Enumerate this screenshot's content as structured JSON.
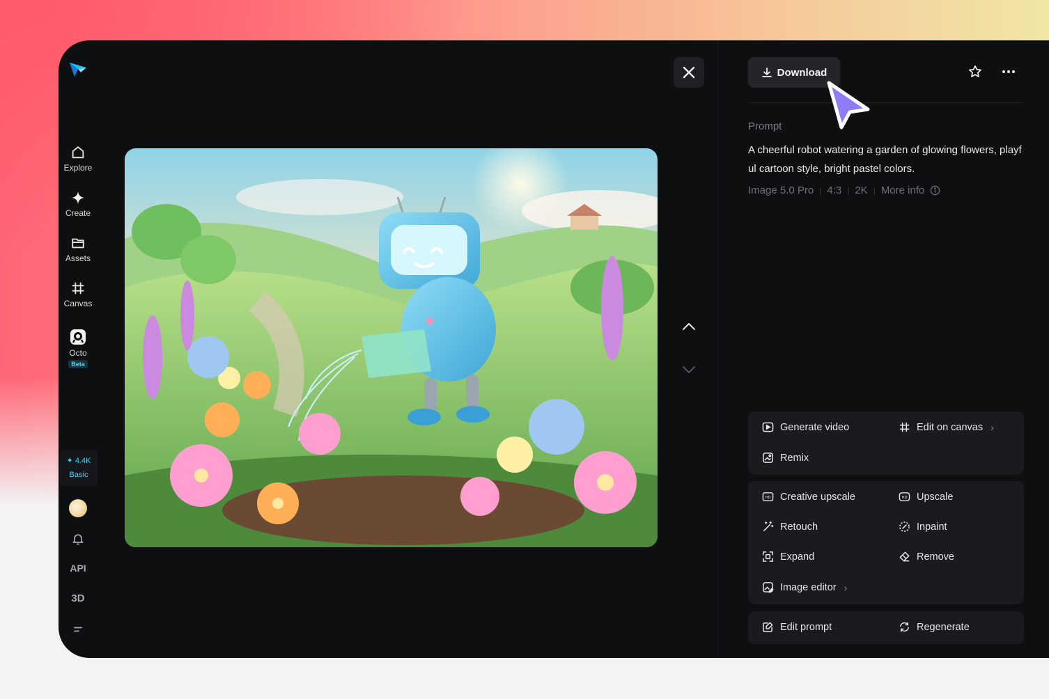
{
  "sidebar": {
    "items": [
      {
        "label": "Explore",
        "icon": "home-icon"
      },
      {
        "label": "Create",
        "icon": "sparkle-icon"
      },
      {
        "label": "Assets",
        "icon": "folder-icon"
      },
      {
        "label": "Canvas",
        "icon": "canvas-icon"
      },
      {
        "label": "Octo",
        "icon": "octo-icon",
        "badge": "Beta"
      }
    ],
    "credits": "4.4K",
    "plan": "Basic",
    "api_label": "API",
    "threed_label": "3D"
  },
  "toolbar": {
    "download_label": "Download"
  },
  "prompt": {
    "label": "Prompt",
    "text": "A cheerful robot watering a garden of glowing flowers, playful cartoon style, bright pastel colors.",
    "model": "Image 5.0 Pro",
    "ratio": "4:3",
    "resolution": "2K",
    "more_info": "More info"
  },
  "actions": {
    "generate_video": "Generate video",
    "edit_on_canvas": "Edit on canvas",
    "remix": "Remix",
    "creative_upscale": "Creative upscale",
    "upscale": "Upscale",
    "retouch": "Retouch",
    "inpaint": "Inpaint",
    "expand": "Expand",
    "remove": "Remove",
    "image_editor": "Image editor",
    "edit_prompt": "Edit prompt",
    "regenerate": "Regenerate"
  },
  "colors": {
    "accent": "#3ad0ff",
    "cursor": "#8e7cf6",
    "panel": "#1a1b1f"
  }
}
